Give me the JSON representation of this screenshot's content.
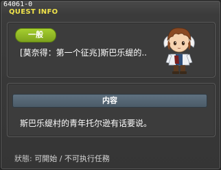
{
  "window": {
    "quest_id": "64061-0",
    "title": "QUEST INFO"
  },
  "quest": {
    "category_badge": "一般",
    "name": "[莫奈得：第一个征兆]斯巴乐缇的.."
  },
  "npc": {
    "icon": "npc-portrait"
  },
  "content": {
    "header": "内容",
    "text": "斯巴乐缇村的青年托尔逊有话要说。"
  },
  "status": {
    "label": "狀態:",
    "value": "可開始 / 不可执行任務"
  },
  "colors": {
    "title": "#f2e54a",
    "badge": "#8dba22",
    "section_header": "#55677a"
  }
}
